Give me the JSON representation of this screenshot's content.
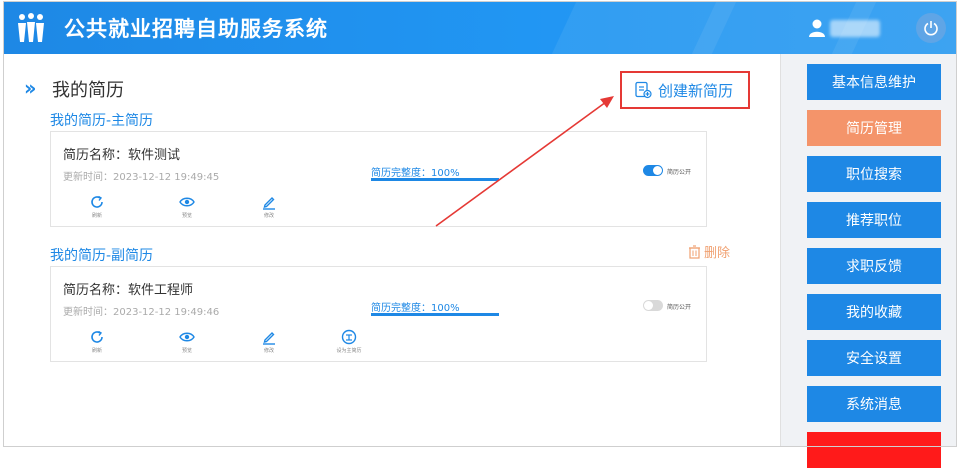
{
  "header": {
    "title": "公共就业招聘自助服务系统",
    "colors": {
      "header_bg": "#1e88e5"
    }
  },
  "page": {
    "title": "我的简历",
    "create_button": "创建新简历"
  },
  "resumes": {
    "main_group_title": "我的简历-主简历",
    "secondary_group_title": "我的简历-副简历",
    "delete_label": "删除",
    "main": {
      "name": "简历名称：软件测试",
      "updated": "更新时间：2023-12-12 19:49:45",
      "completion_label": "简历完整度：100%",
      "completion": 1.0,
      "public_toggle_label": "简历公开",
      "public": true,
      "actions": [
        {
          "label": "刷新",
          "icon": "refresh-icon"
        },
        {
          "label": "预览",
          "icon": "eye-icon"
        },
        {
          "label": "修改",
          "icon": "edit-icon"
        }
      ]
    },
    "secondary": {
      "name": "简历名称：软件工程师",
      "updated": "更新时间：2023-12-12 19:49:46",
      "completion_label": "简历完整度：100%",
      "completion": 1.0,
      "public_toggle_label": "简历公开",
      "public": false,
      "actions": [
        {
          "label": "刷新",
          "icon": "refresh-icon"
        },
        {
          "label": "预览",
          "icon": "eye-icon"
        },
        {
          "label": "修改",
          "icon": "edit-icon"
        },
        {
          "label": "设为主简历",
          "icon": "set-main-icon"
        }
      ]
    }
  },
  "sidebar": {
    "items": [
      {
        "label": "基本信息维护",
        "color": "#1e88e5"
      },
      {
        "label": "简历管理",
        "color": "#f4946a"
      },
      {
        "label": "职位搜索",
        "color": "#1e88e5"
      },
      {
        "label": "推荐职位",
        "color": "#1e88e5"
      },
      {
        "label": "求职反馈",
        "color": "#1e88e5"
      },
      {
        "label": "我的收藏",
        "color": "#1e88e5"
      },
      {
        "label": "安全设置",
        "color": "#1e88e5"
      },
      {
        "label": "系统消息",
        "color": "#1e88e5"
      },
      {
        "label": "",
        "color": "#ff1a1a"
      }
    ]
  },
  "annotation": {
    "color": "#e53935"
  }
}
